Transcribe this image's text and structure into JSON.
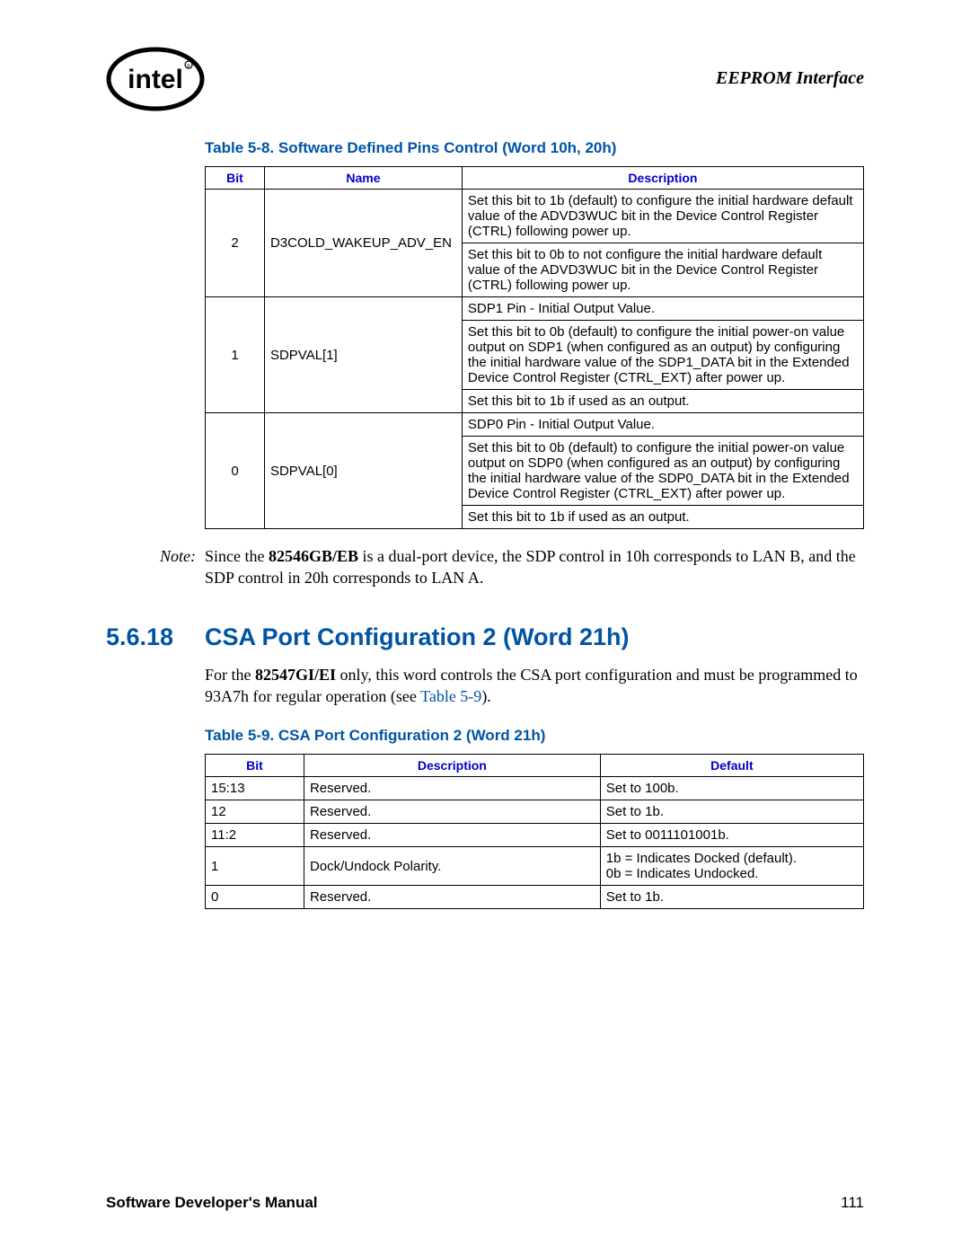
{
  "header": {
    "title": "EEPROM Interface"
  },
  "table58": {
    "caption": "Table 5-8. Software Defined Pins Control (Word 10h, 20h)",
    "headers": {
      "bit": "Bit",
      "name": "Name",
      "desc": "Description"
    },
    "rows": [
      {
        "bit": "2",
        "name": "D3COLD_WAKEUP_ADV_EN",
        "descs": [
          "Set this bit to 1b (default) to configure the initial hardware default value of the ADVD3WUC bit in the Device Control Register (CTRL) following power up.",
          "Set this bit to 0b to not configure the initial hardware default value of the ADVD3WUC bit in the Device Control Register (CTRL) following power up."
        ]
      },
      {
        "bit": "1",
        "name": "SDPVAL[1]",
        "descs": [
          "SDP1 Pin - Initial Output Value.",
          "Set this bit to 0b (default) to configure the initial power-on value output on SDP1 (when configured as an output) by configuring the initial hardware value of the SDP1_DATA bit in the Extended Device Control Register (CTRL_EXT) after power up.",
          "Set this bit to 1b if used as an output."
        ]
      },
      {
        "bit": "0",
        "name": "SDPVAL[0]",
        "descs": [
          "SDP0 Pin - Initial Output Value.",
          "Set this bit to 0b (default) to configure the initial power-on value output on SDP0 (when configured as an output) by configuring the initial hardware value of the SDP0_DATA bit in the Extended Device Control Register (CTRL_EXT) after power up.",
          "Set this bit to 1b if used as an output."
        ]
      }
    ]
  },
  "note": {
    "label": "Note:",
    "pre": "Since the ",
    "bold": "82546GB/EB",
    "post": " is a dual-port device, the SDP control in 10h corresponds to LAN B, and the SDP control in 20h corresponds to LAN A."
  },
  "section": {
    "num": "5.6.18",
    "title": "CSA Port Configuration 2 (Word 21h)"
  },
  "para": {
    "pre": "For the ",
    "bold": "82547GI/EI",
    "mid": " only, this word controls the CSA port configuration and must be programmed to 93A7h for regular operation (see ",
    "link": "Table 5-9",
    "post": ")."
  },
  "table59": {
    "caption": "Table 5-9. CSA Port Configuration 2 (Word 21h)",
    "headers": {
      "bit": "Bit",
      "desc": "Description",
      "def": "Default"
    },
    "rows": [
      {
        "bit": "15:13",
        "desc": "Reserved.",
        "def": "Set to 100b."
      },
      {
        "bit": "12",
        "desc": "Reserved.",
        "def": "Set to 1b."
      },
      {
        "bit": "11:2",
        "desc": "Reserved.",
        "def": "Set to 0011101001b."
      },
      {
        "bit": "1",
        "desc": "Dock/Undock Polarity.",
        "def1": "1b = Indicates Docked (default).",
        "def2": "0b = Indicates Undocked."
      },
      {
        "bit": "0",
        "desc": "Reserved.",
        "def": "Set to 1b."
      }
    ]
  },
  "footer": {
    "left": "Software Developer's Manual",
    "right": "111"
  }
}
